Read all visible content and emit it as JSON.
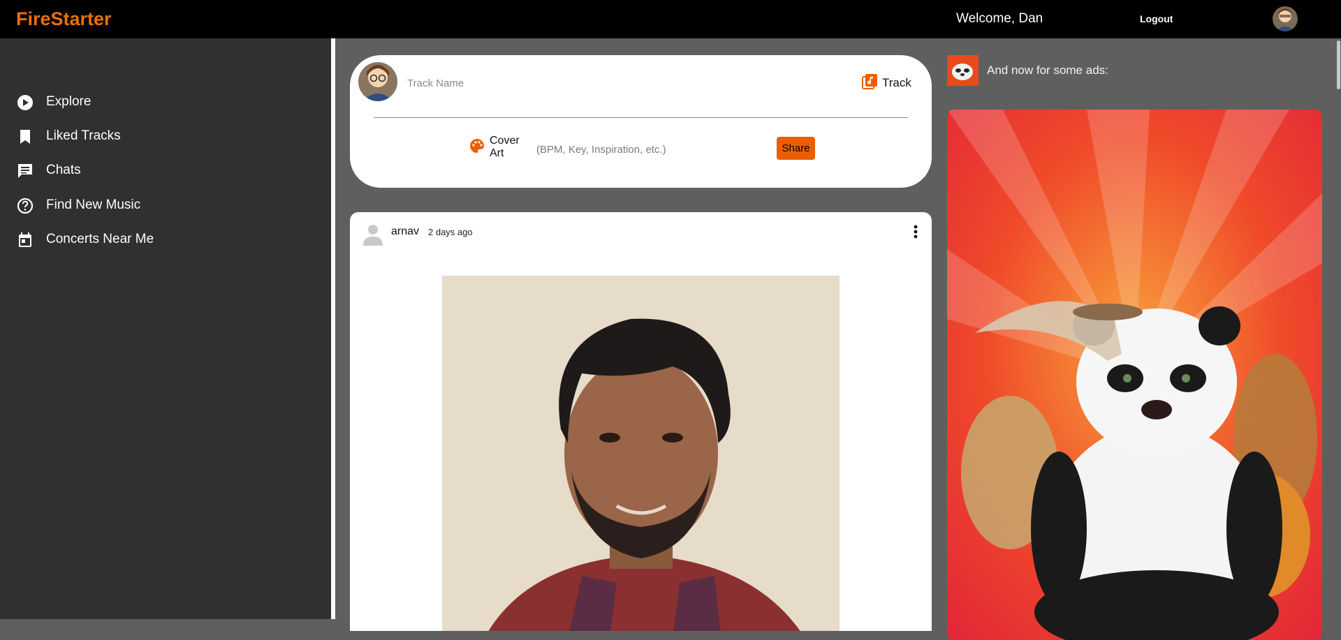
{
  "header": {
    "brand": "FireStarter",
    "welcome": "Welcome, Dan",
    "logout_label": "Logout",
    "avatar_icon": "user-avatar-icon"
  },
  "sidebar": {
    "items": [
      {
        "label": "Explore",
        "icon": "play-circle-icon"
      },
      {
        "label": "Liked Tracks",
        "icon": "bookmark-icon"
      },
      {
        "label": "Chats",
        "icon": "chat-icon"
      },
      {
        "label": "Find New Music",
        "icon": "help-circle-icon"
      },
      {
        "label": "Concerts Near Me",
        "icon": "calendar-icon"
      }
    ]
  },
  "composer": {
    "track_name_placeholder": "Track Name",
    "track_button_label": "Track",
    "cover_art_label": "Cover Art",
    "details_placeholder": "(BPM, Key, Inspiration, etc.)",
    "share_label": "Share"
  },
  "post": {
    "author": "arnav",
    "time": "2 days ago"
  },
  "ads": {
    "header_text": "And now for some ads:"
  },
  "colors": {
    "brand": "#e96f0c",
    "accent": "#ec5f00",
    "sidebar_bg": "#303030",
    "page_bg": "#5f5f5f"
  }
}
